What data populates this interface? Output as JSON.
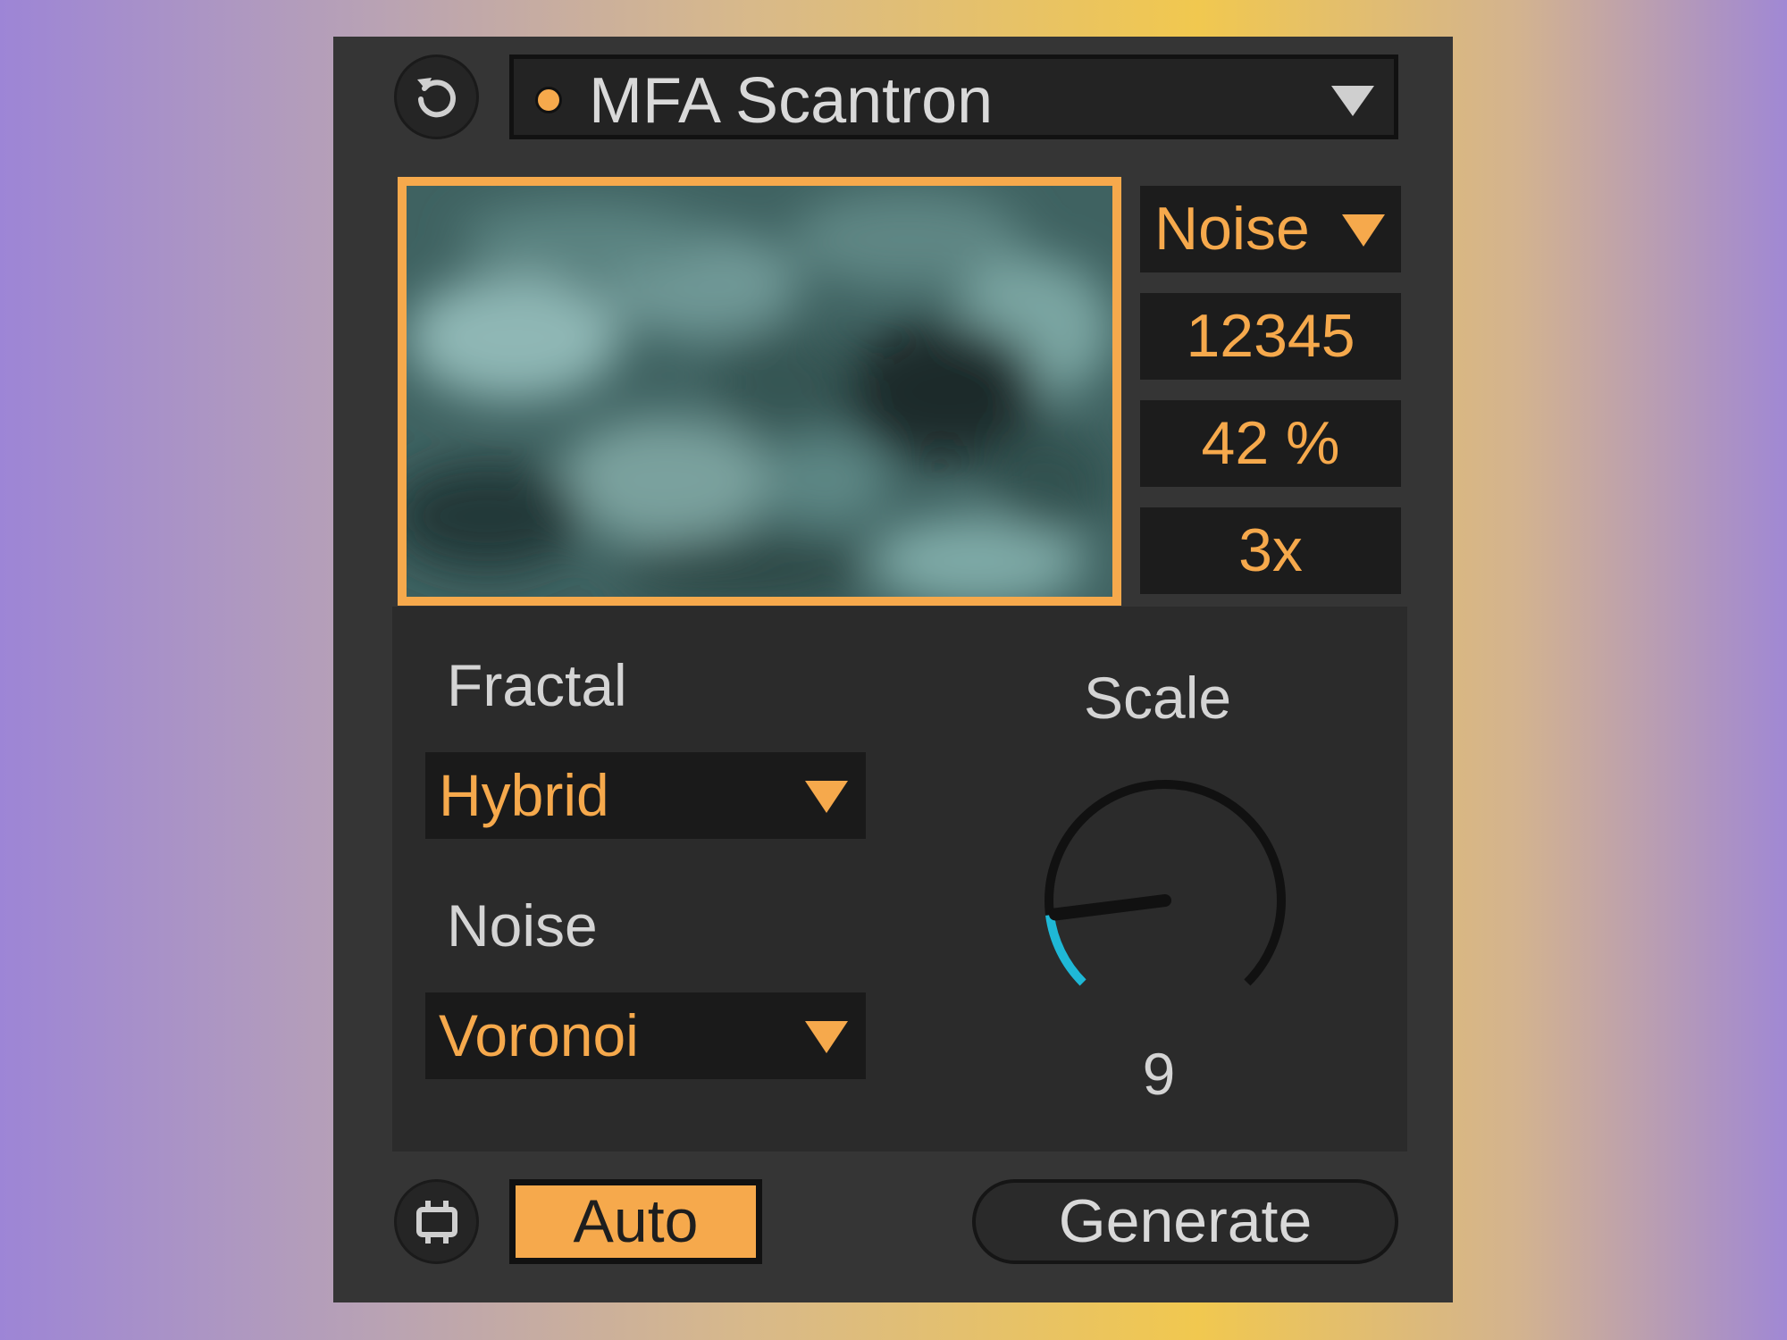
{
  "device": {
    "title": "MFA Scantron",
    "status_dot_color": "#f6a94c",
    "reset_icon": "reset-icon",
    "menu_icon": "chevron-down-icon"
  },
  "preview": {
    "accent_color": "#f6a94c",
    "content": "noise-texture-image"
  },
  "side_controls": {
    "mode": "Noise",
    "seed": "12345",
    "amount": "42 %",
    "multiplier": "3x"
  },
  "fractal": {
    "label": "Fractal",
    "value": "Hybrid"
  },
  "noise": {
    "label": "Noise",
    "value": "Voronoi"
  },
  "scale_knob": {
    "label": "Scale",
    "value": "9",
    "level": 0.14,
    "track_color": "#111111",
    "fill_color": "#1fb8d6"
  },
  "footer": {
    "hotswap_icon": "hot-swap-icon",
    "auto_label": "Auto",
    "generate_label": "Generate"
  }
}
